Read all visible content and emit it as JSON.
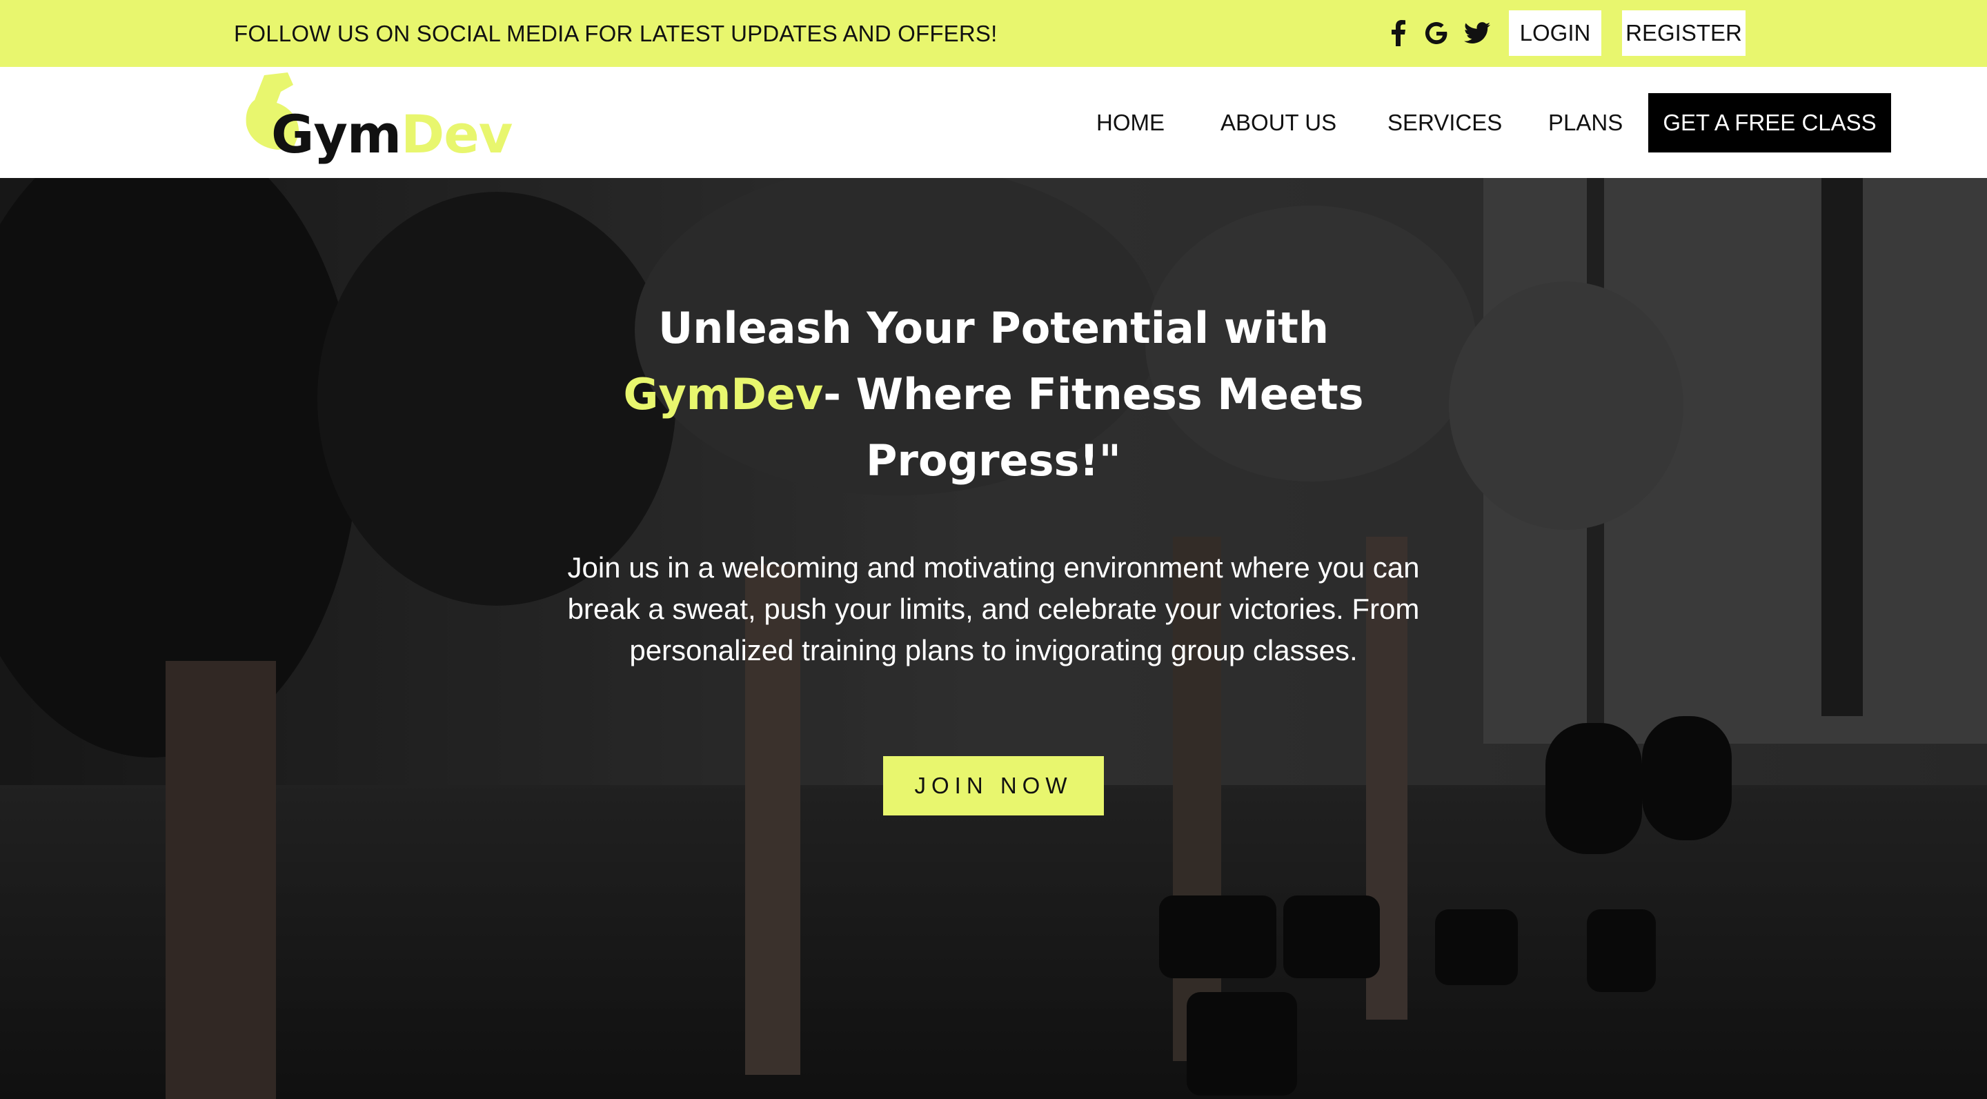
{
  "topbar": {
    "announcement": "FOLLOW US ON SOCIAL MEDIA FOR LATEST UPDATES AND OFFERS!",
    "social_icons": [
      "facebook-icon",
      "google-icon",
      "twitter-icon"
    ],
    "login_label": "LOGIN",
    "register_label": "REGISTER",
    "background_color": "#e8f66e"
  },
  "navbar": {
    "logo": {
      "part1": "Gym",
      "part2": "Dev"
    },
    "items": [
      {
        "label": "HOME"
      },
      {
        "label": "ABOUT US"
      },
      {
        "label": "SERVICES"
      },
      {
        "label": "PLANS"
      }
    ],
    "cta_label": "GET A FREE CLASS"
  },
  "hero": {
    "title_line1": "Unleash Your Potential with",
    "title_brand": "GymDev",
    "title_rest": "- Where Fitness Meets Progress!\"",
    "subtitle": "Join us in a welcoming and motivating environment where you can break a sweat, push your limits, and celebrate your victories. From personalized training plans to invigorating group classes.",
    "cta_label": "JOIN NOW"
  },
  "colors": {
    "accent": "#e8f66e",
    "dark": "#000000",
    "text": "#111111"
  }
}
